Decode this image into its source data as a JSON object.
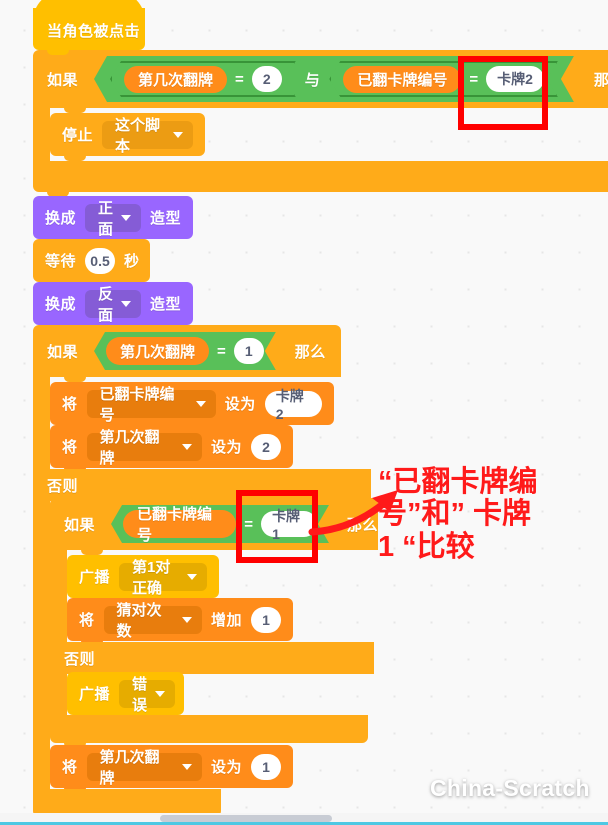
{
  "app": {
    "name": "Scratch 3.0 code canvas",
    "watermark": "China-Scratch"
  },
  "script": {
    "hat": {
      "label": "当角色被点击"
    },
    "if_outer": {
      "if_label": "如果",
      "then_label": "那么",
      "condition": {
        "operator_label": "与",
        "left": {
          "variable": "第几次翻牌",
          "operator": "=",
          "value": "2"
        },
        "right": {
          "variable": "已翻卡牌编号",
          "operator": "=",
          "value": "卡牌2"
        }
      },
      "body": [
        {
          "type": "control-stop",
          "label": "停止",
          "option": "这个脚本"
        }
      ]
    },
    "switch_costume_1": {
      "label_pre": "换成",
      "option": "正面",
      "label_post": "造型"
    },
    "wait": {
      "label_pre": "等待",
      "value": "0.5",
      "label_post": "秒"
    },
    "switch_costume_2": {
      "label_pre": "换成",
      "option": "反面",
      "label_post": "造型"
    },
    "if_else_outer": {
      "if_label": "如果",
      "then_label": "那么",
      "else_label": "否则",
      "condition": {
        "variable": "第几次翻牌",
        "operator": "=",
        "value": "1"
      },
      "then_body": [
        {
          "type": "set-var",
          "label_pre": "将",
          "variable": "已翻卡牌编号",
          "label_post": "设为",
          "value": "卡牌2"
        },
        {
          "type": "set-var",
          "label_pre": "将",
          "variable": "第几次翻牌",
          "label_post": "设为",
          "value": "2"
        }
      ],
      "else_body": {
        "if_else_inner": {
          "if_label": "如果",
          "then_label": "那么",
          "else_label": "否则",
          "condition": {
            "variable": "已翻卡牌编号",
            "operator": "=",
            "value": "卡牌1"
          },
          "then_body": [
            {
              "type": "broadcast",
              "label": "广播",
              "option": "第1对正确"
            },
            {
              "type": "change-var",
              "label_pre": "将",
              "variable": "猜对次数",
              "label_post": "增加",
              "value": "1"
            }
          ],
          "else_body": [
            {
              "type": "broadcast",
              "label": "广播",
              "option": "错误"
            }
          ]
        },
        "after": [
          {
            "type": "set-var",
            "label_pre": "将",
            "variable": "第几次翻牌",
            "label_post": "设为",
            "value": "1"
          }
        ]
      }
    }
  },
  "annotations": {
    "note": "“已翻卡牌编\n号”和” 卡牌\n1 “比较",
    "highlight_1_target": "卡牌2",
    "highlight_2_target": "卡牌1"
  },
  "colors": {
    "events_yellow": "#FFBF00",
    "control_orange": "#FFAB19",
    "control_orange_dark": "#EC9C13",
    "looks_purple": "#9966FF",
    "looks_purple_dark": "#855CD6",
    "variables_orange": "#FF8C1A",
    "variables_orange_dark": "#E87D0D",
    "operators_green": "#59C059",
    "operators_green_dark": "#389438",
    "annotation_red": "#FF1A1A",
    "canvas_bg": "#F9F9F9"
  }
}
